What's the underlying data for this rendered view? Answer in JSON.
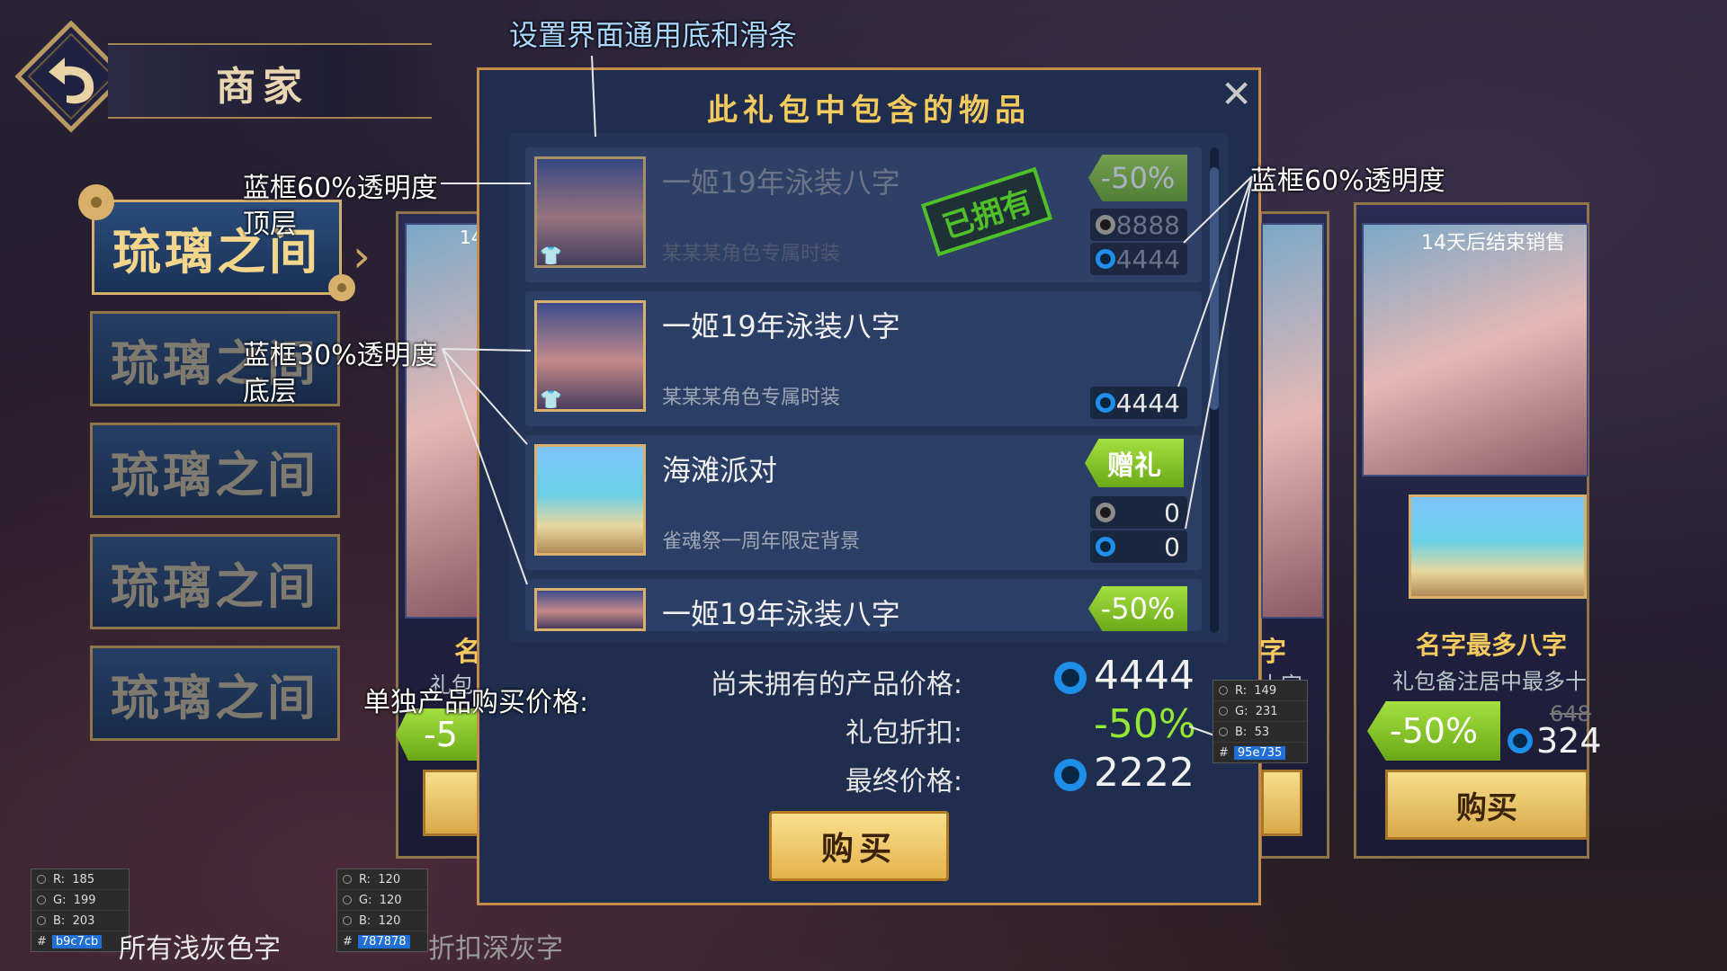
{
  "header": {
    "title": "商家"
  },
  "tabs": [
    {
      "label": "琉璃之间"
    },
    {
      "label": "琉璃之间"
    },
    {
      "label": "琉璃之间"
    },
    {
      "label": "琉璃之间"
    },
    {
      "label": "琉璃之间"
    }
  ],
  "bg_cards": {
    "right_card": {
      "timer": "14天后结束销售",
      "name": "名字最多八字",
      "desc": "礼包备注居中最多十",
      "old_price": "648",
      "price": "324",
      "discount": "-50%",
      "buy": "购买"
    },
    "left_card": {
      "timer": "14",
      "name_frag": "名",
      "desc_frag": "礼包",
      "discount_frag": "-5"
    },
    "mid_card": {
      "name_frag": "字",
      "desc_frag": "十字"
    }
  },
  "dialog": {
    "title": "此礼包中包含的物品",
    "close": "✕",
    "items": [
      {
        "name": "一姬19年泳装八字",
        "sub": "某某某角色专属时装",
        "tag": "-50%",
        "price_grey": "8888",
        "price_blue": "4444",
        "stamp": "已拥有"
      },
      {
        "name": "一姬19年泳装八字",
        "sub": "某某某角色专属时装",
        "price_blue": "4444"
      },
      {
        "name": "海滩派对",
        "sub": "雀魂祭一周年限定背景",
        "tag": "赠礼",
        "price_grey": "0",
        "price_blue": "0"
      },
      {
        "name": "一姬19年泳装八字",
        "tag": "-50%"
      }
    ],
    "summary": {
      "unowned_label": "尚未拥有的产品价格:",
      "unowned_value": "4444",
      "discount_label": "礼包折扣:",
      "discount_value": "-50%",
      "final_label": "最终价格:",
      "final_value": "2222"
    },
    "buy": "购买"
  },
  "annotations": {
    "top": "设置界面通用底和滑条",
    "left_top_1": "蓝框60%透明度",
    "left_top_2": "顶层",
    "left_bottom_1": "蓝框30%透明度",
    "left_bottom_2": "底层",
    "right": "蓝框60%透明度",
    "single_price": "单独产品购买价格:",
    "light_grey": "所有浅灰色字",
    "dark_grey": "折扣深灰字"
  },
  "swatches": [
    {
      "r": "185",
      "g": "199",
      "b": "203",
      "hex": "b9c7cb"
    },
    {
      "r": "120",
      "g": "120",
      "b": "120",
      "hex": "787878"
    },
    {
      "r": "149",
      "g": "231",
      "b": "53",
      "hex": "95e735"
    }
  ],
  "colors": {
    "accent_green": "#95e735",
    "light_grey_text": "#b9c7cb",
    "dark_grey_text": "#787878",
    "gold": "#f4c95d"
  },
  "icons": [
    "back-arrow-icon",
    "close-icon",
    "coin-blue-icon",
    "coin-grey-icon",
    "shirt-icon"
  ]
}
